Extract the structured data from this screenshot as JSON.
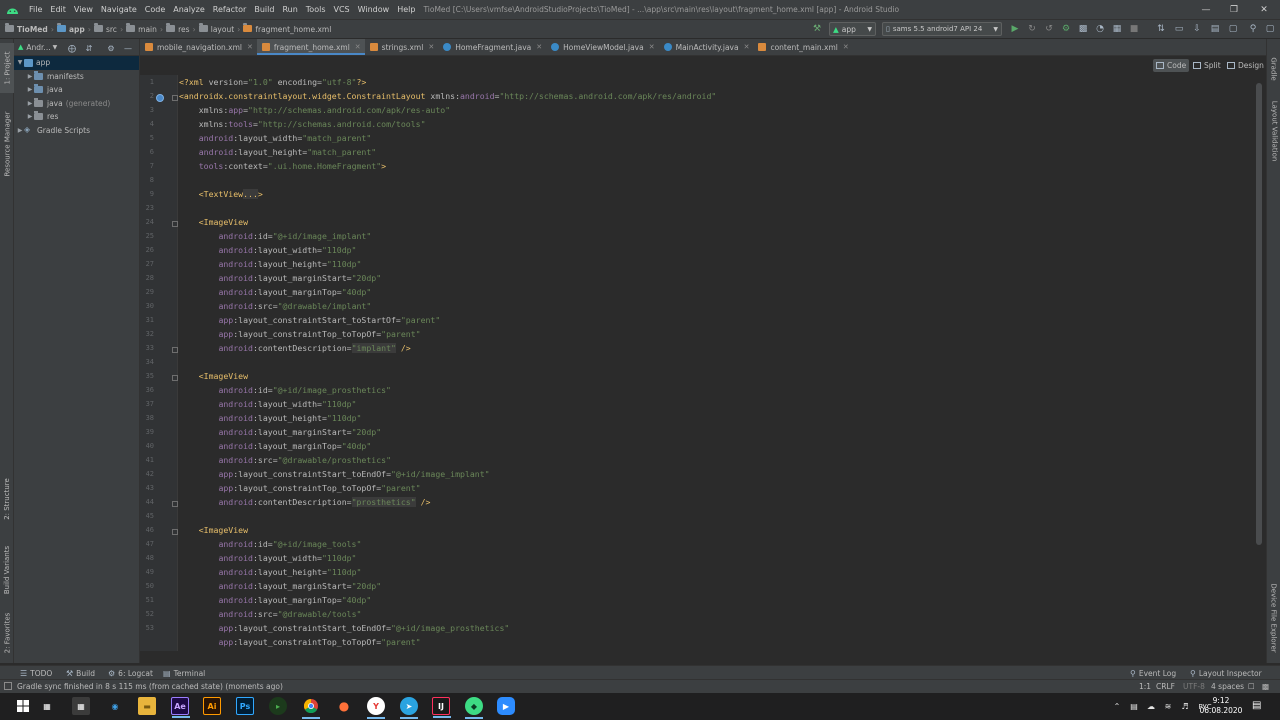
{
  "menubar": {
    "items": [
      "File",
      "Edit",
      "View",
      "Navigate",
      "Code",
      "Analyze",
      "Refactor",
      "Build",
      "Run",
      "Tools",
      "VCS",
      "Window",
      "Help"
    ],
    "title": "TioMed [C:\\Users\\vmfse\\AndroidStudioProjects\\TioMed] - ...\\app\\src\\main\\res\\layout\\fragment_home.xml [app] - Android Studio"
  },
  "navbar": {
    "breadcrumbs": [
      "TioMed",
      "app",
      "src",
      "main",
      "res",
      "layout",
      "fragment_home.xml"
    ],
    "run_config": "app",
    "device": "sams 5.5 android7 API 24"
  },
  "left_strip": {
    "project": "1: Project",
    "resource_manager": "Resource Manager",
    "structure": "2: Structure",
    "build_variants": "Build Variants",
    "favorites": "2: Favorites"
  },
  "right_strip": {
    "gradle": "Gradle",
    "layout_validation": "Layout Validation",
    "device_file_explorer": "Device File Explorer"
  },
  "project_panel": {
    "view_mode": "Andr...",
    "tree": [
      {
        "label": "app",
        "extra": ""
      },
      {
        "label": "manifests",
        "extra": ""
      },
      {
        "label": "java",
        "extra": ""
      },
      {
        "label": "java",
        "extra": "(generated)"
      },
      {
        "label": "res",
        "extra": ""
      },
      {
        "label": "Gradle Scripts",
        "extra": ""
      }
    ]
  },
  "editor_tabs": [
    {
      "label": "mobile_navigation.xml",
      "kind": "xml"
    },
    {
      "label": "fragment_home.xml",
      "kind": "xml"
    },
    {
      "label": "strings.xml",
      "kind": "xml"
    },
    {
      "label": "HomeFragment.java",
      "kind": "java"
    },
    {
      "label": "HomeViewModel.java",
      "kind": "java"
    },
    {
      "label": "MainActivity.java",
      "kind": "java"
    },
    {
      "label": "content_main.xml",
      "kind": "xml"
    }
  ],
  "view_toggle": {
    "code": "Code",
    "split": "Split",
    "design": "Design"
  },
  "editor": {
    "line_numbers": [
      "1",
      "2",
      "3",
      "4",
      "5",
      "6",
      "7",
      "8",
      "9",
      "23",
      "24",
      "25",
      "26",
      "27",
      "28",
      "29",
      "30",
      "31",
      "32",
      "33",
      "34",
      "35",
      "36",
      "37",
      "38",
      "39",
      "40",
      "41",
      "42",
      "43",
      "44",
      "45",
      "46",
      "47",
      "48",
      "49",
      "50",
      "51",
      "52",
      "53"
    ],
    "lines": [
      "<?xml version=\"1.0\" encoding=\"utf-8\"?>",
      "<androidx.constraintlayout.widget.ConstraintLayout xmlns:android=\"http://schemas.android.com/apk/res/android\"",
      "    xmlns:app=\"http://schemas.android.com/apk/res-auto\"",
      "    xmlns:tools=\"http://schemas.android.com/tools\"",
      "    android:layout_width=\"match_parent\"",
      "    android:layout_height=\"match_parent\"",
      "    tools:context=\".ui.home.HomeFragment\">",
      "",
      "    <TextView...>",
      "",
      "    <ImageView",
      "        android:id=\"@+id/image_implant\"",
      "        android:layout_width=\"110dp\"",
      "        android:layout_height=\"110dp\"",
      "        android:layout_marginStart=\"20dp\"",
      "        android:layout_marginTop=\"40dp\"",
      "        android:src=\"@drawable/implant\"",
      "        app:layout_constraintStart_toStartOf=\"parent\"",
      "        app:layout_constraintTop_toTopOf=\"parent\"",
      "        android:contentDescription=\"implant\" />",
      "",
      "    <ImageView",
      "        android:id=\"@+id/image_prosthetics\"",
      "        android:layout_width=\"110dp\"",
      "        android:layout_height=\"110dp\"",
      "        android:layout_marginStart=\"20dp\"",
      "        android:layout_marginTop=\"40dp\"",
      "        android:src=\"@drawable/prosthetics\"",
      "        app:layout_constraintStart_toEndOf=\"@+id/image_implant\"",
      "        app:layout_constraintTop_toTopOf=\"parent\"",
      "        android:contentDescription=\"prosthetics\" />",
      "",
      "    <ImageView",
      "        android:id=\"@+id/image_tools\"",
      "        android:layout_width=\"110dp\"",
      "        android:layout_height=\"110dp\"",
      "        android:layout_marginStart=\"20dp\"",
      "        android:layout_marginTop=\"40dp\"",
      "        android:src=\"@drawable/tools\"",
      "        app:layout_constraintStart_toEndOf=\"@+id/image_prosthetics\"",
      "        app:layout_constraintTop_toTopOf=\"parent\""
    ]
  },
  "bottom_tools": {
    "todo": "TODO",
    "build": "Build",
    "logcat": "6: Logcat",
    "terminal": "Terminal",
    "event_log": "Event Log",
    "layout_inspector": "Layout Inspector"
  },
  "statusbar": {
    "message": "Gradle sync finished in 8 s 115 ms (from cached state) (moments ago)",
    "position": "1:1",
    "line_sep": "CRLF",
    "encoding": "UTF-8",
    "indent": "4 spaces"
  },
  "taskbar": {
    "language": "РУС",
    "time": "9:12",
    "date": "06.08.2020",
    "apps": [
      "start-button",
      "task-view",
      "file-explorer",
      "edge",
      "folder",
      "adobe-after-effects",
      "adobe-illustrator",
      "adobe-photoshop",
      "app-green",
      "chrome",
      "firefox",
      "yandex",
      "telegram",
      "intellij",
      "android-studio",
      "zoom"
    ]
  },
  "colors": {
    "background": "#2b2b2b",
    "panel": "#3c3f41",
    "tag": "#e8bf6a",
    "namespace": "#9876aa",
    "value": "#6a8759",
    "accent": "#4a88c7"
  }
}
